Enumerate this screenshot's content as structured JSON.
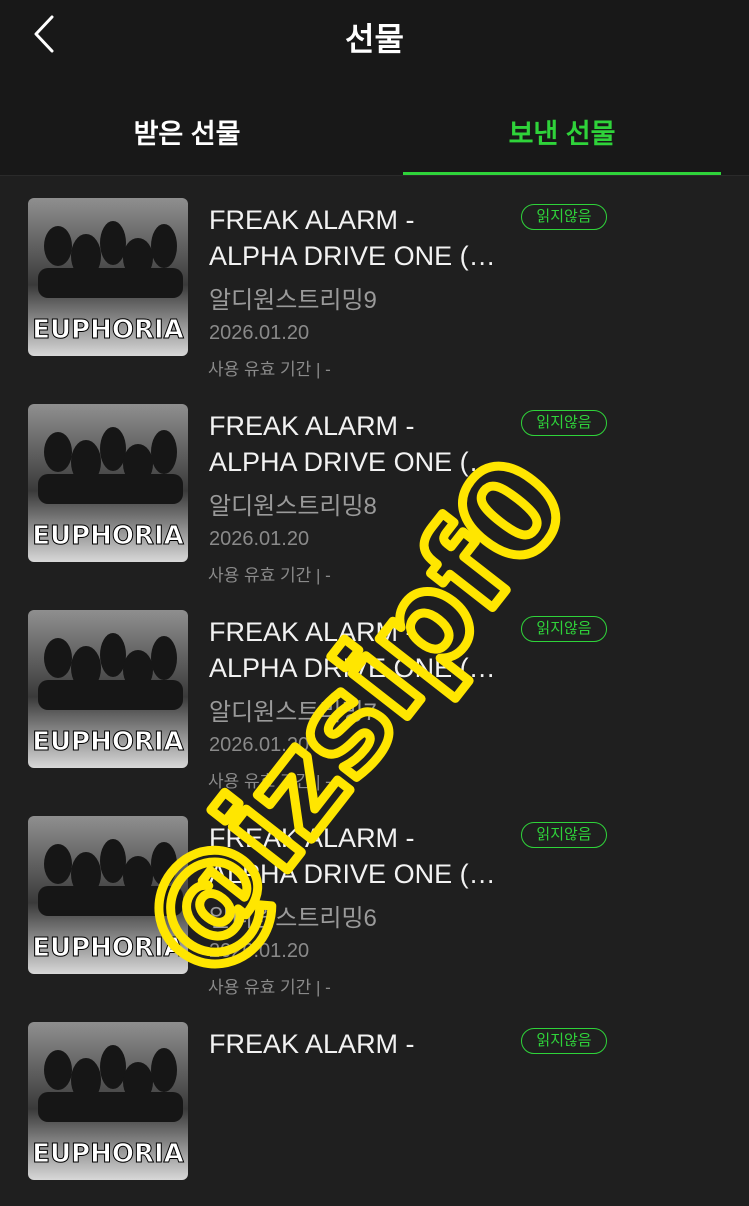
{
  "header": {
    "title": "선물",
    "back_icon": "chevron-left-icon"
  },
  "tabs": [
    {
      "label": "받은 선물",
      "active": false
    },
    {
      "label": "보낸 선물",
      "active": true
    }
  ],
  "colors": {
    "accent": "#2fd33a",
    "background": "#1f1f1f",
    "watermark": "#ffe600"
  },
  "gifts": [
    {
      "title_line1": "FREAK ALARM -",
      "title_line2": "ALPHA DRIVE ONE (…",
      "sender": "알디원스트리밍9",
      "date": "2026.01.20",
      "validity": "사용 유효 기간  |   -",
      "badge": "읽지않음",
      "cover_text": "EUPHORIA"
    },
    {
      "title_line1": "FREAK ALARM -",
      "title_line2": "ALPHA DRIVE ONE (…",
      "sender": "알디원스트리밍8",
      "date": "2026.01.20",
      "validity": "사용 유효 기간  |   -",
      "badge": "읽지않음",
      "cover_text": "EUPHORIA"
    },
    {
      "title_line1": "FREAK ALARM -",
      "title_line2": "ALPHA DRIVE ONE (…",
      "sender": "알디원스트리밍7",
      "date": "2026.01.20",
      "validity": "사용 유효 기간  |   -",
      "badge": "읽지않음",
      "cover_text": "EUPHORIA"
    },
    {
      "title_line1": "FREAK ALARM -",
      "title_line2": "ALPHA DRIVE ONE (…",
      "sender": "알디원스트리밍6",
      "date": "2026.01.20",
      "validity": "사용 유효 기간  |   -",
      "badge": "읽지않음",
      "cover_text": "EUPHORIA"
    },
    {
      "title_line1": "FREAK ALARM -",
      "title_line2": "",
      "sender": "",
      "date": "",
      "validity": "",
      "badge": "읽지않음",
      "cover_text": "EUPHORIA"
    }
  ],
  "watermark": {
    "text": "@izsipf0"
  }
}
